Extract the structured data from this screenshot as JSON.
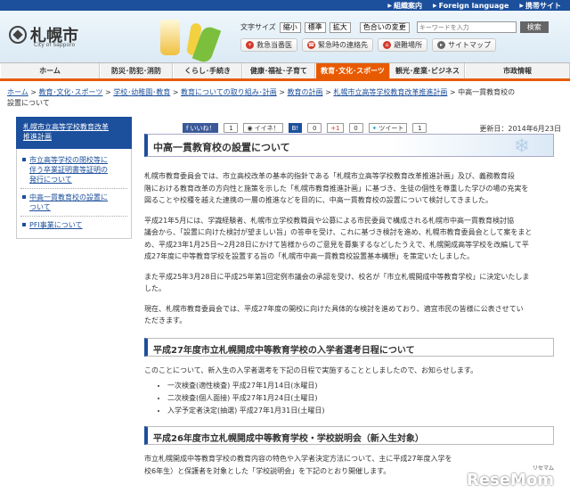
{
  "topbar": {
    "links": [
      "組織案内",
      "Foreign language",
      "携帯サイト"
    ]
  },
  "header": {
    "logo_name": "札幌市",
    "logo_sub": "City of Sapporo",
    "text_size_label": "文字サイズ",
    "size_buttons": [
      "縮小",
      "標準",
      "拡大"
    ],
    "color_button": "色合いの変更",
    "search_placeholder": "キーワードを入力",
    "search_button": "検索",
    "quick_links": [
      "救急当番医",
      "緊急時の連絡先",
      "避難場所",
      "サイトマップ"
    ]
  },
  "nav": {
    "items": [
      "ホーム",
      "防災･防犯･消防",
      "くらし･手続き",
      "健康･福祉･子育て",
      "教育･文化･スポーツ",
      "観光･産業･ビジネス",
      "市政情報"
    ],
    "active_index": 4
  },
  "breadcrumb": {
    "links": [
      "ホーム",
      "教育･文化･スポーツ",
      "学校･幼稚園･教育",
      "教育についての取り組み･計画",
      "教育の計画",
      "札幌市立高等学校教育改革推進計画"
    ],
    "current_a": "中高一貫教育校の",
    "current_b": "設置について"
  },
  "sidebar": {
    "heading_a": "札幌市立高等学校教育改革",
    "heading_b": "推進計画",
    "items": [
      {
        "lines": [
          "市立高等学校の閉校等に",
          "伴う卒業証明書等証明の",
          "発行について"
        ]
      },
      {
        "lines": [
          "中高一貫教育校の設置に",
          "ついて"
        ]
      },
      {
        "lines": [
          "PFI事業について"
        ]
      }
    ]
  },
  "social": {
    "fb_label": "いいね！",
    "fb_count": "1",
    "mixi_label": "イイネ！",
    "b_count": "0",
    "g_label": "+1",
    "g_count": "0",
    "tweet_label": "ツイート",
    "tweet_count": "1"
  },
  "updated": "更新日：2014年6月23日",
  "main": {
    "title": "中高一貫教育校の設置について",
    "p1": [
      "札幌市教育委員会では、市立高校改革の基本的指針である「札幌市立高等学校教育改革推進計画」及び、義務教育段",
      "階における教育改革の方向性と施策を示した「札幌市教育推進計画」に基づき、生徒の個性を尊重した学びの場の充実を",
      "図ることや校種を越えた連携の一層の推進などを目的に、中高一貫教育校の設置について検討してきました。"
    ],
    "p2": [
      "平成21年5月には、学識経験者、札幌市立学校教職員や公募による市民委員で構成される札幌市中高一貫教育検討協",
      "議会から、「設置に向けた検討が望ましい旨」の答申を受け、これに基づき検討を進め、札幌市教育委員会として案をまと",
      "め、平成23年1月25日～2月28日にかけて皆様からのご意見を募集するなどしたうえで、札幌開成高等学校を改編して平",
      "成27年度に中等教育学校を設置する旨の「札幌市中高一貫教育校設置基本構想」を策定いたしました。"
    ],
    "p3": [
      "また平成25年3月28日に平成25年第1回定例市議会の承認を受け、校名が「市立札幌開成中等教育学校」に決定いたしま",
      "した。"
    ],
    "p4": [
      "現在、札幌市教育委員会では、平成27年度の開校に向けた具体的な検討を進めており、適宜市民の皆様に公表させてい",
      "ただきます。"
    ],
    "h2a": "平成27年度市立札幌開成中等教育学校の入学者選考日程について",
    "p5": "このことについて、新入生の入学者選考を下記の日程で実施することとしましたので、お知らせします。",
    "schedule": [
      "一次検査(適性検査) 平成27年1月14日(水曜日)",
      "二次検査(個人面接) 平成27年1月24日(土曜日)",
      "入学予定者決定(抽選) 平成27年1月31日(土曜日)"
    ],
    "h2b": "平成26年度市立札幌開成中等教育学校・学校説明会（新入生対象）",
    "p6": [
      "市立札幌開成中等教育学校の教育内容の特色や入学者決定方法について、主に平成27年度入学を",
      "校6年生）と保護者を対象とした「学校説明会」を下記のとおり開催します。"
    ]
  },
  "watermark": {
    "text": "ReseMom",
    "sub": "リセマム"
  }
}
